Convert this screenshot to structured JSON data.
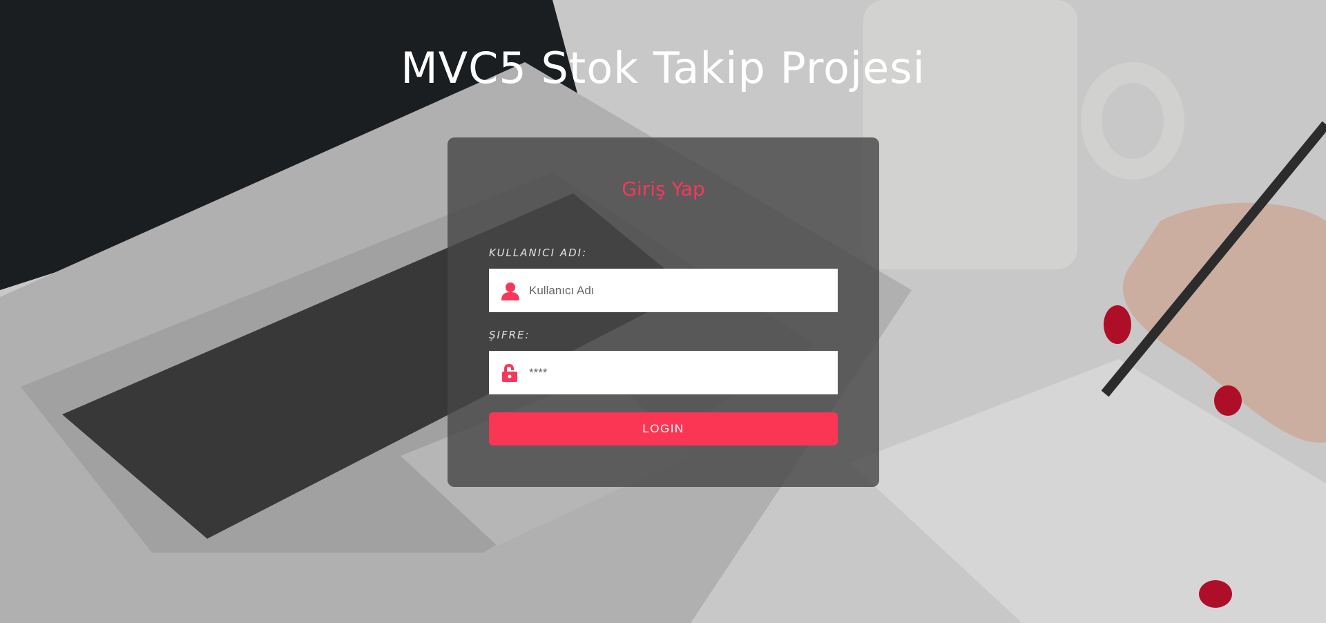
{
  "page": {
    "title": "MVC5 Stok Takip Projesi"
  },
  "login_card": {
    "title": "Giriş Yap",
    "username": {
      "label": "KULLANICI ADI:",
      "placeholder": "Kullanıcı Adı",
      "value": "",
      "icon": "user-icon"
    },
    "password": {
      "label": "ŞIFRE:",
      "placeholder": "****",
      "value": "",
      "icon": "unlock-icon"
    },
    "submit_label": "LOGIN"
  },
  "colors": {
    "accent": "#fb3654",
    "title_accent": "#f9375a",
    "card_bg": "rgba(70,70,70,0.80)"
  }
}
